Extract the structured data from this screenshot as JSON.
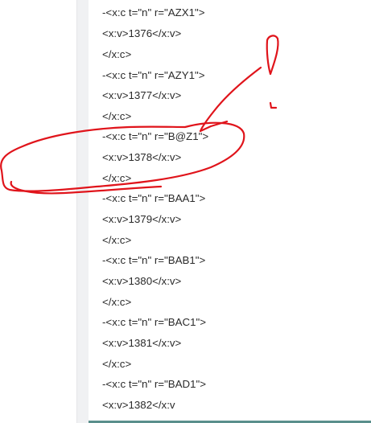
{
  "xml_viewer": {
    "lines": [
      "-<x:c t=\"n\" r=\"AZX1\">",
      "<x:v>1376</x:v>",
      "</x:c>",
      "-<x:c t=\"n\" r=\"AZY1\">",
      "<x:v>1377</x:v>",
      "</x:c>",
      "-<x:c t=\"n\" r=\"B@Z1\">",
      "<x:v>1378</x:v>",
      "</x:c>",
      "-<x:c t=\"n\" r=\"BAA1\">",
      "<x:v>1379</x:v>",
      "</x:c>",
      "-<x:c t=\"n\" r=\"BAB1\">",
      "<x:v>1380</x:v>",
      "</x:c>",
      "-<x:c t=\"n\" r=\"BAC1\">",
      "<x:v>1381</x:v>",
      "</x:c>",
      "-<x:c t=\"n\" r=\"BAD1\">",
      "<x:v>1382</x:v"
    ]
  },
  "annotation": {
    "color": "#e0141b"
  }
}
